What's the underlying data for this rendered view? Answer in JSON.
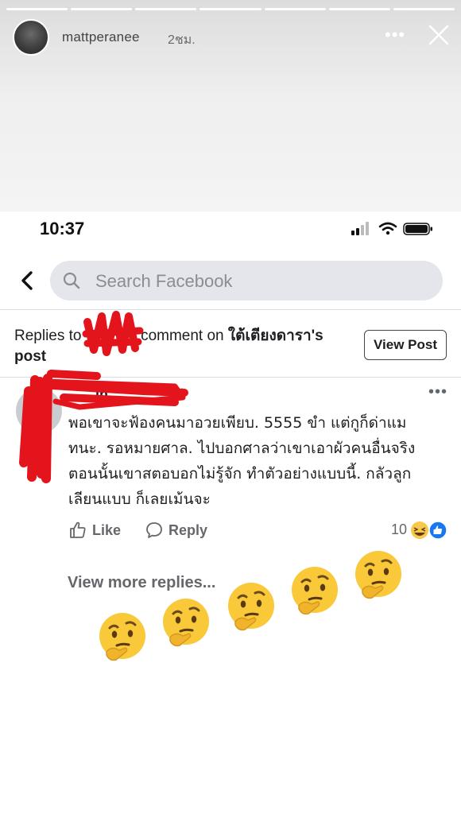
{
  "story": {
    "username": "mattperanee",
    "time": "2ชม.",
    "progress_segments": 7
  },
  "status_bar": {
    "time": "10:37"
  },
  "search": {
    "placeholder": "Search Facebook"
  },
  "replies_header": {
    "prefix": "Replies to",
    "middle": "comment on",
    "page_name": "ใต้เตียงดารา",
    "suffix": "'s",
    "post_word": "post",
    "view_post_label": "View Post"
  },
  "comment": {
    "name": "... ...in",
    "ago": "d",
    "body": "พอเขาจะฟ้องคนมาอวยเพียบ. 5555 ขำ แต่กูก็ด่าแม ทนะ. รอหมายศาล. ไปบอกศาลว่าเขาเอาผัวคนอื่นจริง ตอนนั้นเขาสตอบอกไม่รู้จัก ทำตัวอย่างแบบนี้. กลัวลูก เลียนแบบ ก็เลยเม้นจะ",
    "like_label": "Like",
    "reply_label": "Reply",
    "reaction_count": "10",
    "view_more": "View more replies..."
  },
  "colors": {
    "scribble": "#e3141b",
    "fb_blue": "#1877f2"
  },
  "icons": [
    "more-dots-icon",
    "close-icon",
    "back-arrow-icon",
    "search-icon",
    "like-icon",
    "reply-icon",
    "thinking-face-icon"
  ]
}
